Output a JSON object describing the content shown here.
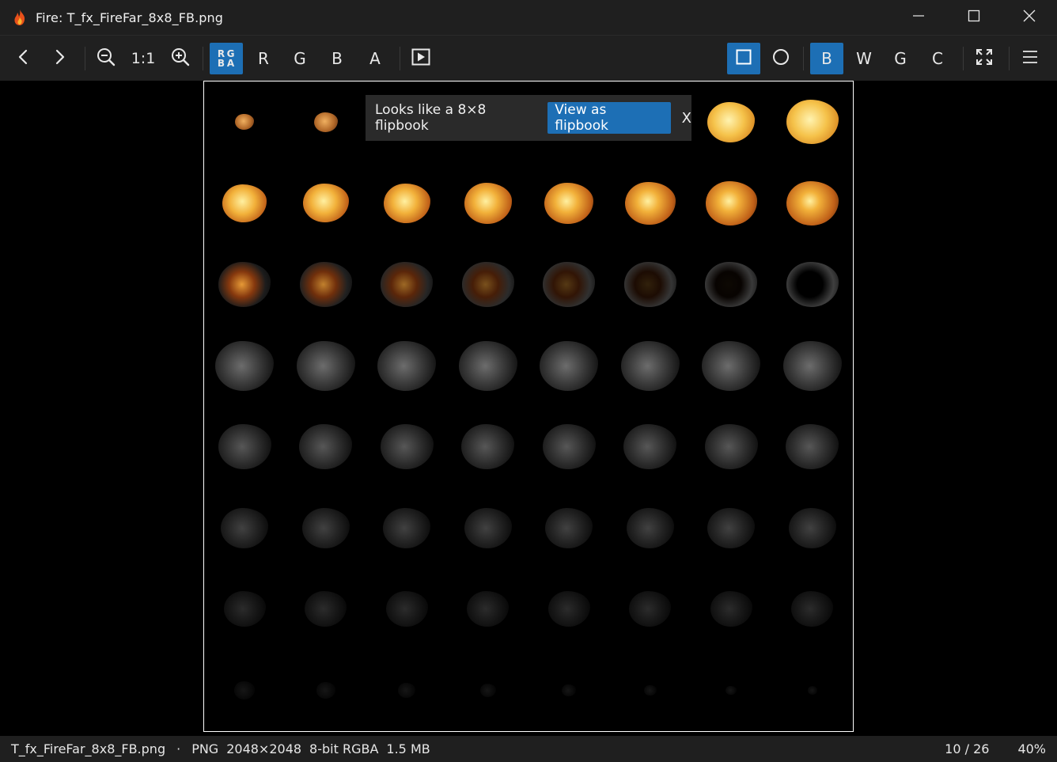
{
  "window": {
    "title": "Fire: T_fx_FireFar_8x8_FB.png"
  },
  "toolbar": {
    "zoom_actual_label": "1:1",
    "channels": {
      "rgba_grid": [
        "R",
        "G",
        "B",
        "A"
      ],
      "r": "R",
      "g": "G",
      "b": "B",
      "a": "A"
    },
    "backgrounds": {
      "black": "B",
      "white": "W",
      "gray": "G",
      "checker": "C"
    },
    "active_channel": "rgba",
    "active_shape": "square",
    "active_background": "black"
  },
  "toast": {
    "message": "Looks like a 8×8 flipbook",
    "action_label": "View as flipbook",
    "close_label": "X"
  },
  "statusbar": {
    "filename": "T_fx_FireFar_8x8_FB.png",
    "separator": "·",
    "format": "PNG",
    "dimensions": "2048×2048",
    "bit_depth": "8-bit RGBA",
    "file_size": "1.5 MB",
    "position": "10 / 26",
    "zoom": "40%"
  },
  "colors": {
    "accent": "#1d6fb5",
    "titlebar": "#1f1f1f",
    "toolbar": "#202020",
    "canvas": "#000000",
    "frame_border": "#ffffff"
  },
  "icons": {
    "app": "fire-icon",
    "minimize": "minimize-icon",
    "maximize": "maximize-icon",
    "close": "close-icon",
    "prev": "chevron-left-icon",
    "next": "chevron-right-icon",
    "zoom_out": "zoom-out-icon",
    "zoom_in": "zoom-in-icon",
    "flipbook": "play-frame-icon",
    "square": "square-icon",
    "circle": "circle-icon",
    "fit": "fit-screen-icon",
    "menu": "hamburger-menu-icon"
  }
}
